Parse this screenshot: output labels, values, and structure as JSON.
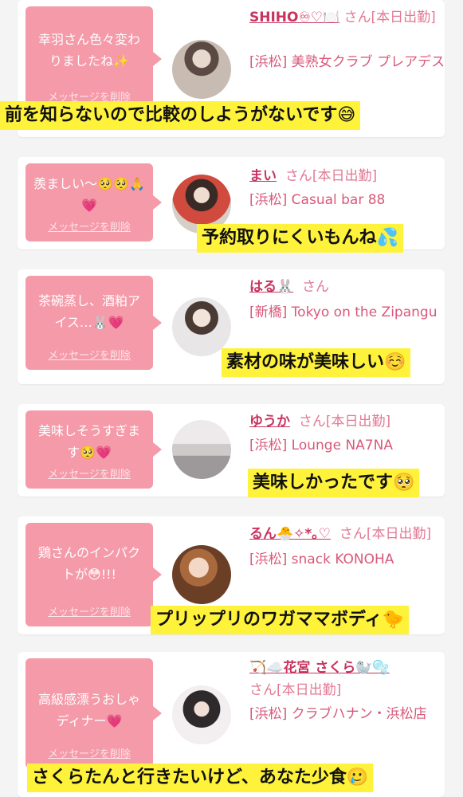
{
  "cards": [
    {
      "message": "幸羽さん色々変わりましたね✨",
      "delete_label": "メッセージを削除",
      "name": "SHIHO♾♡🍽️",
      "san": "さん",
      "status": "[本日出勤]",
      "area": "[浜松]",
      "shop": "美熟女クラブ プレアデス",
      "avatar_icon": "woman-photo-avatar"
    },
    {
      "message": "羨ましい〜🥺🥺🙏💗",
      "delete_label": "メッセージを削除",
      "name": "まい",
      "san": "さん",
      "status": "[本日出勤]",
      "area": "[浜松]",
      "shop": "Casual bar 88",
      "avatar_icon": "woman-photo-avatar"
    },
    {
      "message": "茶碗蒸し、酒粕アイス…🐰💗",
      "delete_label": "メッセージを削除",
      "name": "はる🐰",
      "san": "さん",
      "status": "",
      "area": "[新橋]",
      "shop": "Tokyo on the Zipangu",
      "avatar_icon": "woman-photo-avatar"
    },
    {
      "message": "美味しそうすぎます🥺💗",
      "delete_label": "メッセージを削除",
      "name": "ゆうか",
      "san": "さん",
      "status": "[本日出勤]",
      "area": "[浜松]",
      "shop": "Lounge NA7NA",
      "avatar_icon": "woman-photo-avatar"
    },
    {
      "message": "鶏さんのインパクトが😳!!!",
      "delete_label": "メッセージを削除",
      "name": "るん🐣✧*｡♡",
      "san": "さん",
      "status": "[本日出勤]",
      "area": "[浜松]",
      "shop": "snack KONOHA",
      "avatar_icon": "woman-photo-avatar"
    },
    {
      "message": "高級感漂うおしゃディナー💗",
      "delete_label": "メッセージを削除",
      "name": "🏹☁️花宮 さくら🦭🫧",
      "san": "さん",
      "status": "[本日出勤]",
      "area": "[浜松]",
      "shop": "クラブハナン・浜松店",
      "avatar_icon": "woman-photo-avatar"
    }
  ],
  "captions": [
    "前を知らないので比較のしようがないです😅",
    "予約取りにくいもんね💦",
    "素材の味が美味しい☺️",
    "美味しかったです🥺",
    "プリップリのワガママボディ🐤",
    "さくらたんと行きたいけど、あなた少食🥲"
  ],
  "colors": {
    "bubble": "#f59aa9",
    "name": "#c8345f",
    "text": "#d9587a",
    "caption_bg": "#fff23a"
  }
}
